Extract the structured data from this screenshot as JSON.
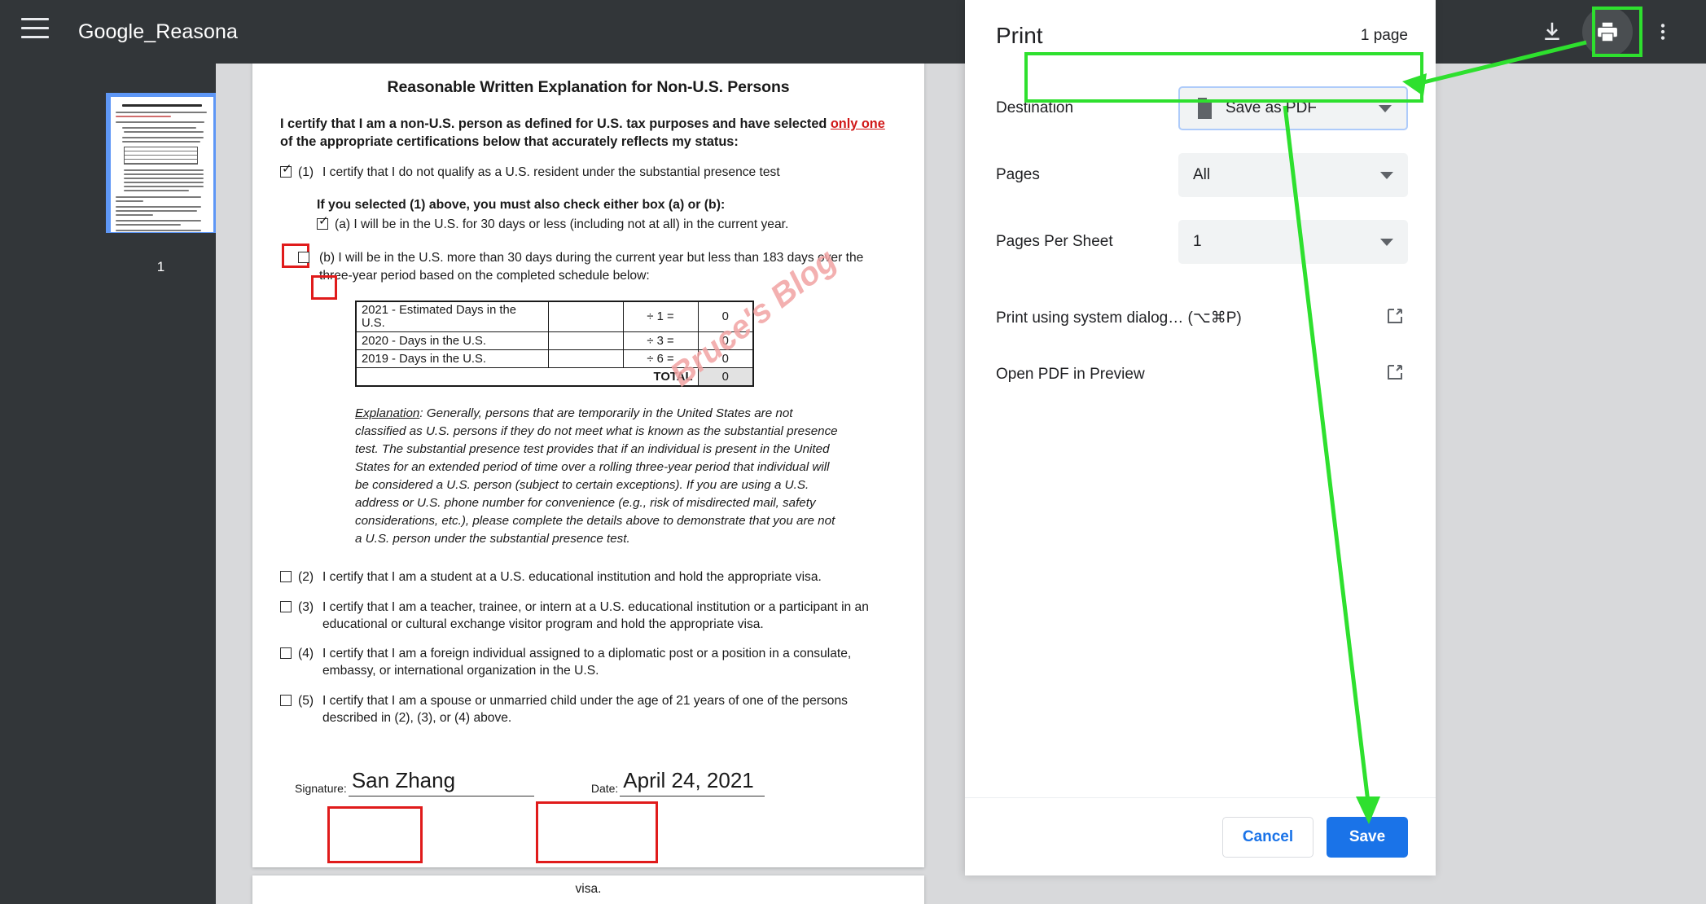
{
  "viewer": {
    "title": "Google_Reasona",
    "menu_icon": "hamburger-icon",
    "download_icon": "download-icon",
    "print_icon": "print-icon",
    "more_icon": "more-vertical-icon",
    "thumbnail_page_number": "1"
  },
  "document": {
    "title": "Reasonable Written Explanation for Non-U.S. Persons",
    "lead_part1": "I certify that I am a non-U.S. person as defined for U.S. tax purposes and have selected ",
    "lead_emphasis": "only one",
    "lead_part2": " of the appropriate certifications below that accurately reflects my status:",
    "item1_num": "(1)",
    "item1_text": "I certify that I do not qualify as a U.S. resident under the substantial presence test",
    "item1_checked": true,
    "subhead": "If you selected (1) above, you must also check either box (a) or (b):",
    "item_a_text": "(a) I will be in the U.S. for 30 days or less (including not at all) in the current year.",
    "item_a_checked": true,
    "item_b_text": "(b) I will be in the U.S. more than 30 days during the current year but less than 183 days over the three-year period based on the completed schedule below:",
    "item_b_checked": false,
    "table": {
      "rows": [
        {
          "label": "2021 - Estimated Days in the U.S.",
          "entry": "",
          "operator": "÷ 1 =",
          "value": "0"
        },
        {
          "label": "2020 - Days in the U.S.",
          "entry": "",
          "operator": "÷ 3 =",
          "value": "0"
        },
        {
          "label": "2019 - Days in the U.S.",
          "entry": "",
          "operator": "÷ 6 =",
          "value": "0"
        }
      ],
      "total_label": "TOTAL",
      "total_value": "0"
    },
    "explanation_label": "Explanation",
    "explanation_text": ": Generally, persons that are temporarily in the United States are not classified as U.S. persons if they do not meet what is known as the substantial presence test. The substantial presence test provides that if an individual is present in the United States for an extended period of time over a rolling three-year period that individual will be considered a U.S. person (subject to certain exceptions). If you are using a U.S. address or U.S. phone number for convenience (e.g., risk of misdirected mail, safety considerations, etc.), please complete the details above to demonstrate that you are not a U.S. person under the substantial presence test.",
    "watermark": "Bruce's Blog",
    "item2_num": "(2)",
    "item2_text": "I certify that I am a student at a U.S. educational institution and hold the appropriate visa.",
    "item3_num": "(3)",
    "item3_text": "I certify that I am a teacher, trainee, or intern at a U.S. educational institution or a participant in an educational or cultural exchange visitor program and hold the appropriate visa.",
    "item4_num": "(4)",
    "item4_text": "I certify that I am a foreign individual assigned to a diplomatic post or a position in a consulate, embassy, or international organization in the U.S.",
    "item5_num": "(5)",
    "item5_text": "I certify that I am a spouse or unmarried child under the age of 21 years of one of the persons described in (2), (3), or (4) above.",
    "signature_label": "Signature:",
    "signature_value": "San Zhang",
    "date_label": "Date:",
    "date_value": "April 24, 2021",
    "next_page_fragment": "visa."
  },
  "print_dialog": {
    "title": "Print",
    "page_count": "1 page",
    "destination_label": "Destination",
    "destination_value": "Save as PDF",
    "destination_icon": "file-icon",
    "pages_label": "Pages",
    "pages_value": "All",
    "pages_per_sheet_label": "Pages Per Sheet",
    "pages_per_sheet_value": "1",
    "system_dialog_label": "Print using system dialog… (⌥⌘P)",
    "system_dialog_icon": "external-link-icon",
    "open_preview_label": "Open PDF in Preview",
    "open_preview_icon": "external-link-icon",
    "cancel_label": "Cancel",
    "save_label": "Save"
  },
  "annotations": {
    "highlight_color": "#2ee02e",
    "redbox_color": "#e01b1b",
    "accent_blue": "#1a73e8"
  }
}
